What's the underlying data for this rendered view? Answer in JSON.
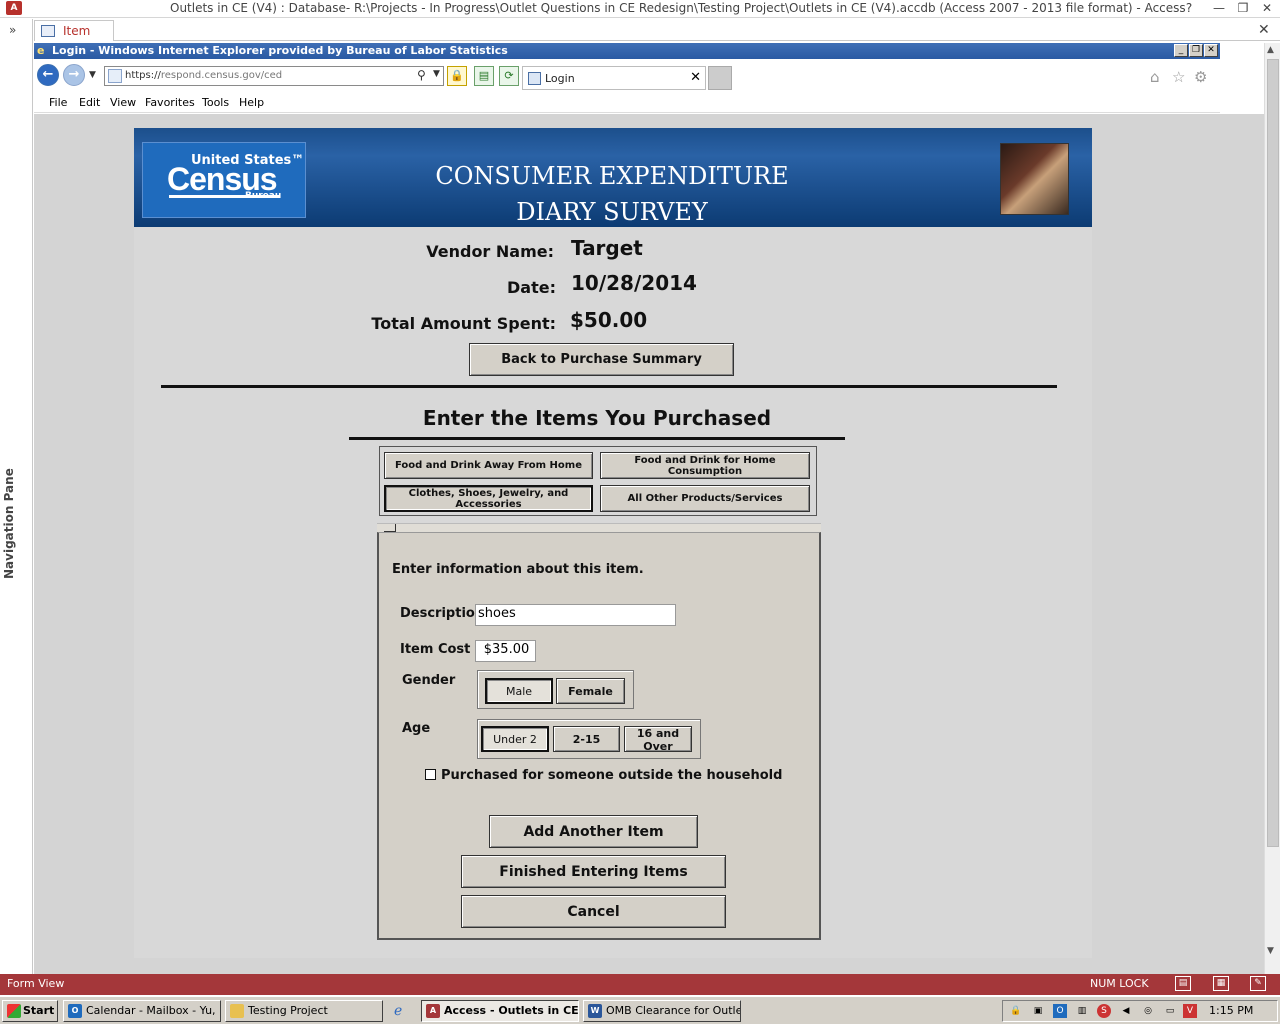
{
  "access": {
    "logo": "A",
    "title": "Outlets in CE (V4) : Database- R:\\Projects - In Progress\\Outlet Questions in CE Redesign\\Testing Project\\Outlets in CE (V4).accdb (Access 2007 - 2013 file format) - Access",
    "nav_pane_label": "Navigation Pane",
    "nav_toggle": "»",
    "doc_tab": "Item",
    "doc_close": "✕",
    "window_controls": [
      "?",
      "—",
      "❐",
      "✕"
    ]
  },
  "ie": {
    "title": "Login - Windows Internet Explorer provided by Bureau of Labor Statistics",
    "url_prefix": "https://",
    "url_rest": "respond.census.gov/ced",
    "tab_label": "Login",
    "menu": [
      "File",
      "Edit",
      "View",
      "Favorites",
      "Tools",
      "Help"
    ],
    "title_buttons": [
      "_",
      "❐",
      "✕"
    ]
  },
  "banner": {
    "logo_top": "United States™",
    "logo_main": "Census",
    "logo_bottom": "Bureau",
    "title_line1": "CONSUMER EXPENDITURE",
    "title_line2": "DIARY SURVEY"
  },
  "summary": {
    "vendor_label": "Vendor Name:",
    "vendor_value": "Target",
    "date_label": "Date:",
    "date_value": "10/28/2014",
    "total_label": "Total Amount Spent:",
    "total_value": "$50.00",
    "back_button": "Back to Purchase Summary"
  },
  "section": {
    "title": "Enter the Items You Purchased",
    "categories": [
      "Food and Drink Away From Home",
      "Food and Drink for Home Consumption",
      "Clothes, Shoes, Jewelry, and Accessories",
      "All Other Products/Services"
    ]
  },
  "item": {
    "heading": "Enter information about this item.",
    "description_label": "Description",
    "description_value": "shoes",
    "cost_label": "Item Cost",
    "cost_value": "$35.00",
    "gender_label": "Gender",
    "gender_options": [
      "Male",
      "Female"
    ],
    "gender_selected": "Male",
    "age_label": "Age",
    "age_options": [
      "Under 2",
      "2-15",
      "16 and Over"
    ],
    "age_selected": "Under 2",
    "outside_household_label": "Purchased for someone outside the household",
    "outside_household_checked": false,
    "add_button": "Add Another Item",
    "finished_button": "Finished Entering Items",
    "cancel_button": "Cancel"
  },
  "statusbar": {
    "view": "Form View",
    "numlock": "NUM LOCK"
  },
  "taskbar": {
    "start": "Start",
    "items": [
      "Calendar - Mailbox - Yu, ...",
      "Testing Project",
      "Access - Outlets in CE ...",
      "OMB Clearance for Outle..."
    ],
    "active_item": "Access - Outlets in CE ...",
    "clock": "1:15 PM"
  },
  "colors": {
    "access_red": "#a4373a",
    "banner_blue": "#1c4f8c",
    "census_blue": "#1f6bbd"
  }
}
